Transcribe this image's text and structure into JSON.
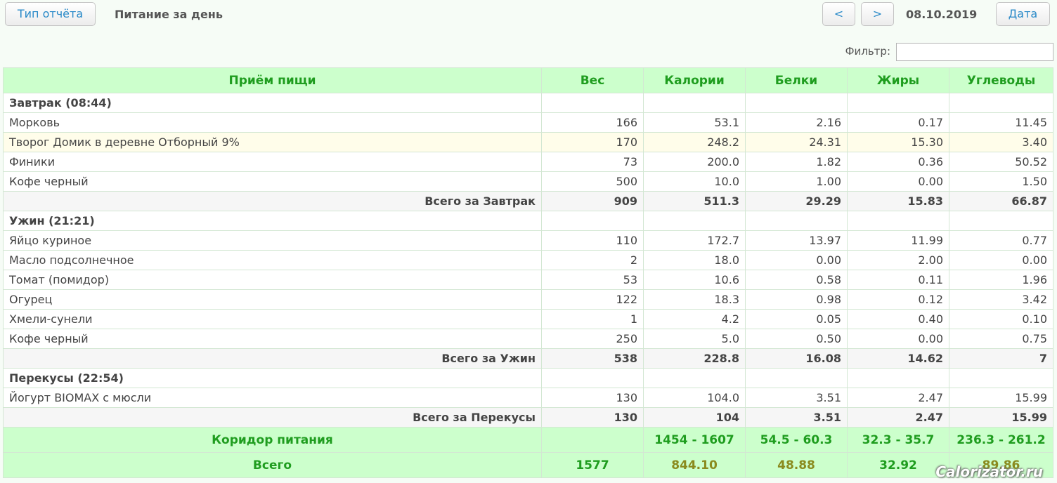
{
  "toolbar": {
    "report_type_label": "Тип отчёта",
    "report_title": "Питание за день",
    "prev_label": "<",
    "next_label": ">",
    "current_date": "08.10.2019",
    "date_button_label": "Дата"
  },
  "filter": {
    "label": "Фильтр:",
    "value": ""
  },
  "table": {
    "headers": [
      "Приём пищи",
      "Вес",
      "Калории",
      "Белки",
      "Жиры",
      "Углеводы"
    ],
    "meals": [
      {
        "title": "Завтрак (08:44)",
        "items": [
          [
            "Морковь",
            "166",
            "53.1",
            "2.16",
            "0.17",
            "11.45"
          ],
          [
            "Творог Домик в деревне Отборный 9%",
            "170",
            "248.2",
            "24.31",
            "15.30",
            "3.40"
          ],
          [
            "Финики",
            "73",
            "200.0",
            "1.82",
            "0.36",
            "50.52"
          ],
          [
            "Кофе черный",
            "500",
            "10.0",
            "1.00",
            "0.00",
            "1.50"
          ]
        ],
        "total": [
          "Всего за Завтрак",
          "909",
          "511.3",
          "29.29",
          "15.83",
          "66.87"
        ]
      },
      {
        "title": "Ужин (21:21)",
        "items": [
          [
            "Яйцо куриное",
            "110",
            "172.7",
            "13.97",
            "11.99",
            "0.77"
          ],
          [
            "Масло подсолнечное",
            "2",
            "18.0",
            "0.00",
            "2.00",
            "0.00"
          ],
          [
            "Томат (помидор)",
            "53",
            "10.6",
            "0.58",
            "0.11",
            "1.96"
          ],
          [
            "Огурец",
            "122",
            "18.3",
            "0.98",
            "0.12",
            "3.42"
          ],
          [
            "Хмели-сунели",
            "1",
            "4.2",
            "0.05",
            "0.40",
            "0.10"
          ],
          [
            "Кофе черный",
            "250",
            "5.0",
            "0.50",
            "0.00",
            "0.75"
          ]
        ],
        "total": [
          "Всего за Ужин",
          "538",
          "228.8",
          "16.08",
          "14.62",
          "7"
        ]
      },
      {
        "title": "Перекусы (22:54)",
        "items": [
          [
            "Йогурт BIOMAX с мюсли",
            "130",
            "104.0",
            "3.51",
            "2.47",
            "15.99"
          ]
        ],
        "total": [
          "Всего за Перекусы",
          "130",
          "104",
          "3.51",
          "2.47",
          "15.99"
        ]
      }
    ],
    "corridor": [
      "Коридор питания",
      "",
      "1454 - 1607",
      "54.5 - 60.3",
      "32.3 - 35.7",
      "236.3 - 261.2"
    ],
    "grand_total": [
      "Всего",
      "1577",
      "844.10",
      "48.88",
      "32.92",
      "89.86"
    ]
  },
  "watermark": "Calorizator.ru",
  "colors": {
    "accent": "#2a8ac8",
    "header_bg": "#ccffcc",
    "header_text": "#1f9d1f",
    "below_norm": "#8a8a1e"
  }
}
